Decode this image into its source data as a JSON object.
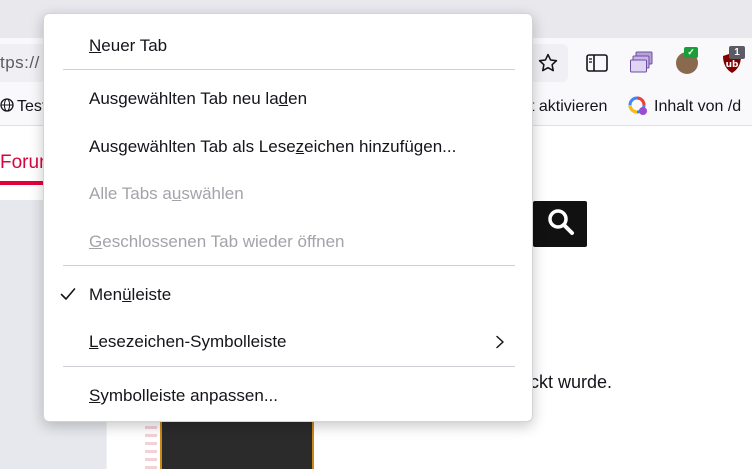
{
  "toolbar": {
    "url_fragment": "tps://",
    "extension_badge_count": "1"
  },
  "bookmarks": {
    "left_label": "Test",
    "middle_label": "t aktivieren",
    "right_label": "Inhalt von /d"
  },
  "page": {
    "active_tab": "Forum",
    "body_text": "lickt wurde."
  },
  "context_menu": {
    "new_tab": {
      "before": "",
      "accel": "N",
      "after": "euer Tab"
    },
    "reload_selected": {
      "before": "Ausgewählten Tab neu la",
      "accel": "d",
      "after": "en"
    },
    "bookmark_selected": {
      "before": "Ausgewählten Tab als Lese",
      "accel": "z",
      "after": "eichen hinzufügen..."
    },
    "select_all": {
      "before": "Alle Tabs a",
      "accel": "u",
      "after": "swählen"
    },
    "reopen_closed": {
      "before": "",
      "accel": "G",
      "after": "eschlossenen Tab wieder öffnen"
    },
    "menubar": {
      "before": "Men",
      "accel": "ü",
      "after": "leiste",
      "checked": true
    },
    "bookmarks_toolbar": {
      "before": "",
      "accel": "L",
      "after": "esezeichen-Symbolleiste",
      "has_submenu": true
    },
    "customize_toolbar": {
      "before": "",
      "accel": "S",
      "after": "ymbolleiste anpassen..."
    }
  },
  "colors": {
    "accent": "#e3003a",
    "disabled_text": "#a3a3aa",
    "menu_bg": "#ffffff"
  }
}
